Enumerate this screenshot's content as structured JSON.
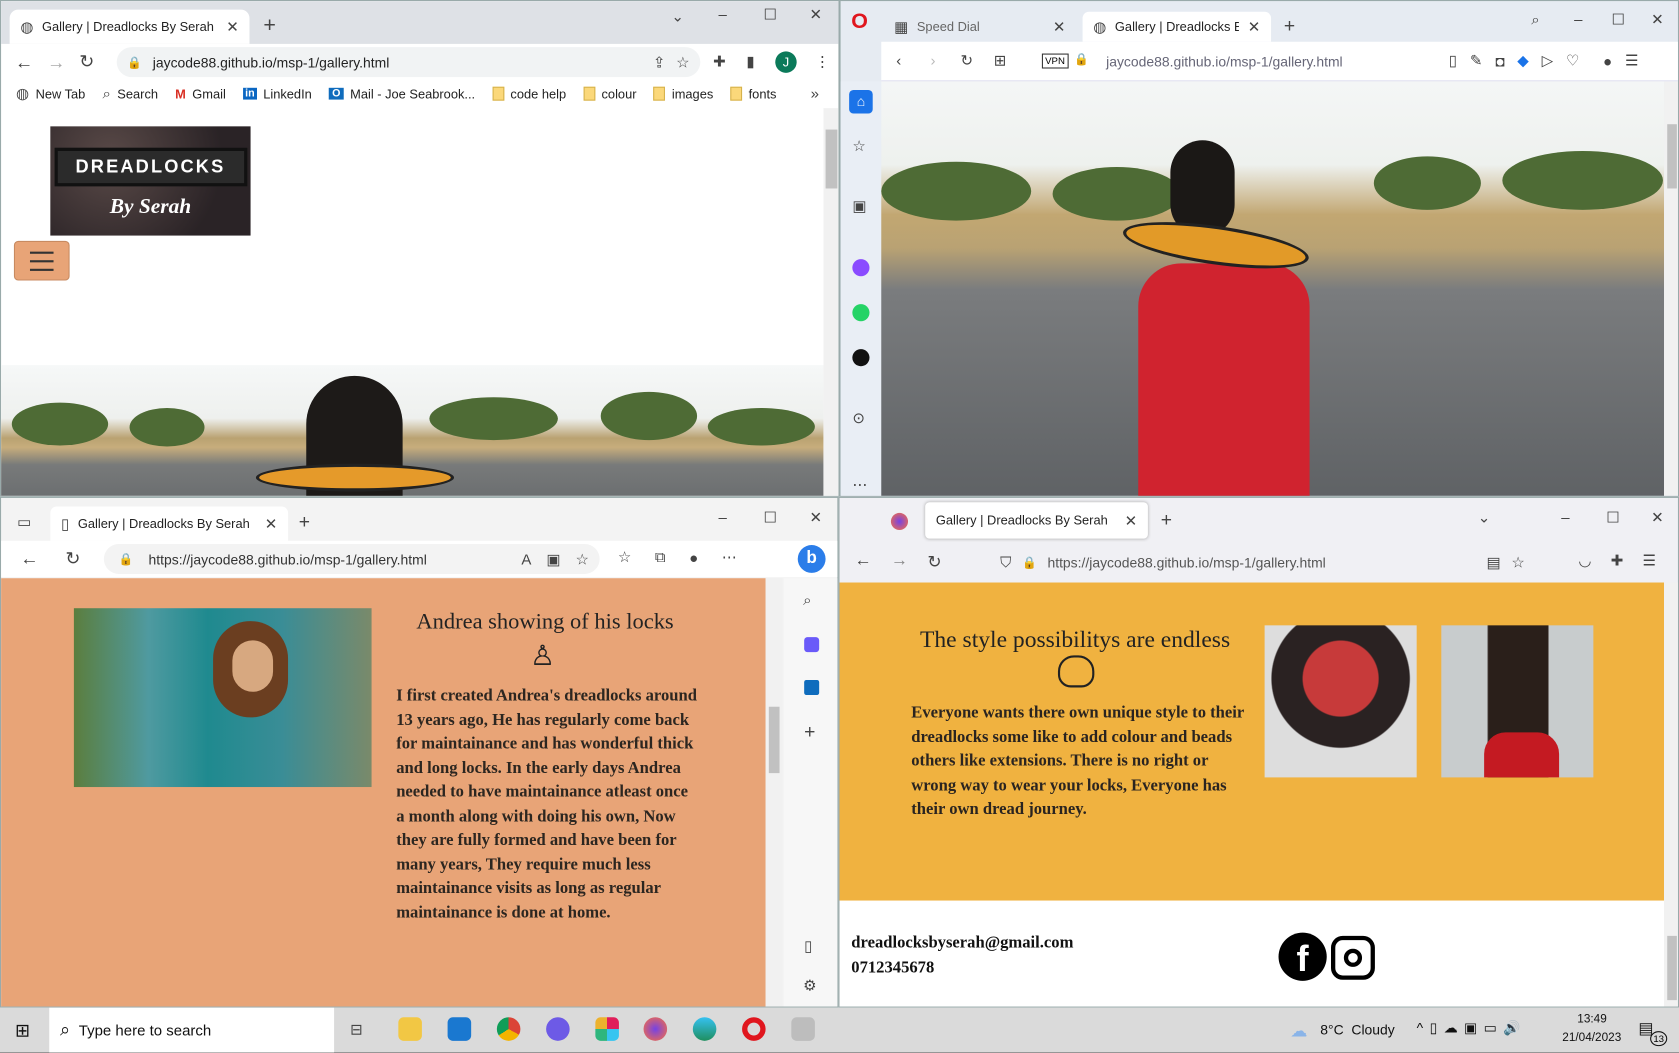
{
  "chrome": {
    "tab_title": "Gallery | Dreadlocks By Serah",
    "url": "jaycode88.github.io/msp-1/gallery.html",
    "profile_initial": "J",
    "bookmarks": [
      "New Tab",
      "Search",
      "Gmail",
      "LinkedIn",
      "Mail - Joe Seabrook...",
      "code help",
      "colour",
      "images",
      "fonts"
    ],
    "logo_line1": "DREADLOCKS",
    "logo_line2": "By Serah"
  },
  "opera": {
    "tabs": [
      "Speed Dial",
      "Gallery | Dreadlocks By Sera"
    ],
    "vpn_label": "VPN",
    "url": "jaycode88.github.io/msp-1/gallery.html"
  },
  "edge": {
    "tab_title": "Gallery | Dreadlocks By Serah",
    "url": "https://jaycode88.github.io/msp-1/gallery.html",
    "heading": "Andrea showing of his locks",
    "paragraph": "I first created Andrea's dreadlocks around 13 years ago, He has regularly come back for maintainance and has wonderful thick and long locks. In the early days Andrea needed to have maintainance atleast once a month along with doing his own, Now they are fully formed and have been for many years, They require much less maintainance visits as long as regular maintainance is done at home.",
    "bg_color": "#e8a477"
  },
  "firefox": {
    "tab_title": "Gallery | Dreadlocks By Serah",
    "url": "https://jaycode88.github.io/msp-1/gallery.html",
    "heading": "The style possibilitys are endless",
    "paragraph": "Everyone wants there own unique style to their dreadlocks some like to add colour and beads others like extensions. There is no right or wrong way to wear your locks, Everyone has their own dread journey.",
    "email": "dreadlocksbyserah@gmail.com",
    "phone": "0712345678",
    "bg_color": "#f0b240"
  },
  "taskbar": {
    "search_placeholder": "Type here to search",
    "weather": "8°C  Cloudy",
    "time": "13:49",
    "date": "21/04/2023",
    "notifications": "13"
  }
}
